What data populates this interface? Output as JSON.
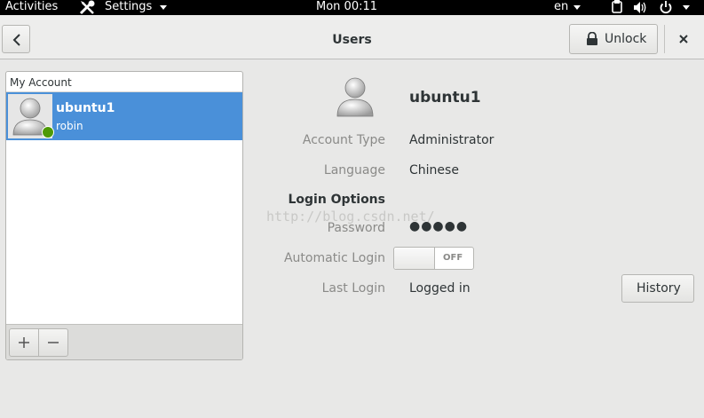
{
  "topbar": {
    "activities": "Activities",
    "app_menu": "Settings",
    "clock": "Mon 00:11",
    "lang": "en"
  },
  "header": {
    "title": "Users",
    "unlock": "Unlock"
  },
  "account_list": {
    "section": "My Account",
    "user": {
      "name": "ubuntu1",
      "subtitle": "robin"
    }
  },
  "details": {
    "name": "ubuntu1",
    "fields": [
      {
        "label": "Account Type",
        "value": "Administrator"
      },
      {
        "label": "Language",
        "value": "Chinese"
      }
    ],
    "login_options": "Login Options",
    "password_label": "Password",
    "password_value": "●●●●●",
    "auto_login_label": "Automatic Login",
    "auto_login_state": "OFF",
    "last_login_label": "Last Login",
    "last_login_value": "Logged in",
    "history": "History"
  },
  "watermark": "http://blog.csdn.net/",
  "colors": {
    "selection": "#4a90d9",
    "online": "#4e9a06",
    "topbar": "#000000"
  }
}
